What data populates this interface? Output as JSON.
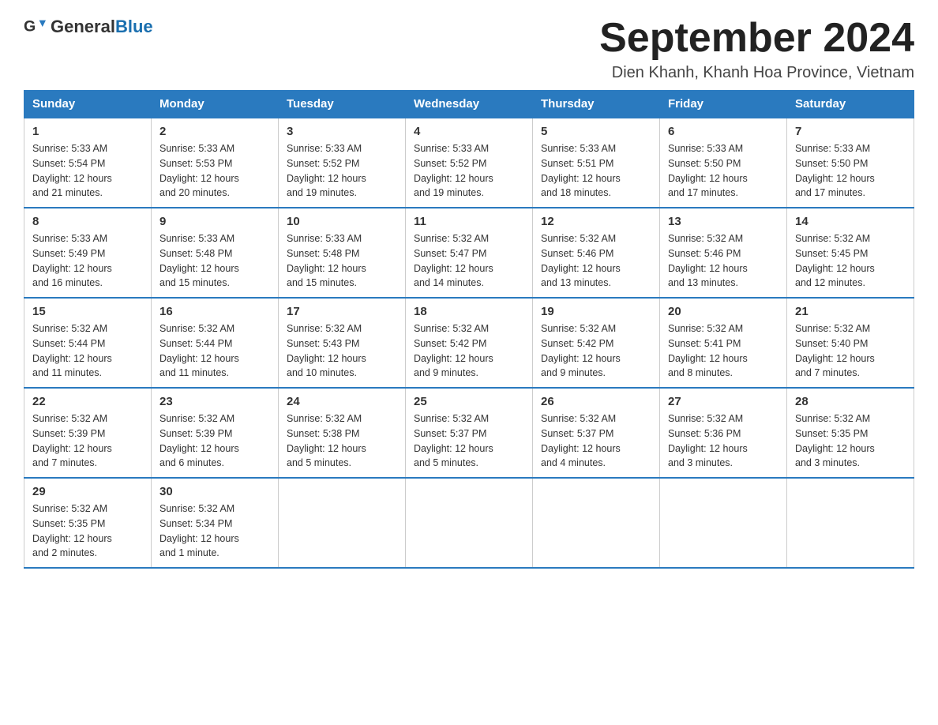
{
  "header": {
    "logo_general": "General",
    "logo_blue": "Blue",
    "month_title": "September 2024",
    "location": "Dien Khanh, Khanh Hoa Province, Vietnam"
  },
  "weekdays": [
    "Sunday",
    "Monday",
    "Tuesday",
    "Wednesday",
    "Thursday",
    "Friday",
    "Saturday"
  ],
  "weeks": [
    [
      {
        "day": "1",
        "sunrise": "5:33 AM",
        "sunset": "5:54 PM",
        "daylight": "12 hours and 21 minutes."
      },
      {
        "day": "2",
        "sunrise": "5:33 AM",
        "sunset": "5:53 PM",
        "daylight": "12 hours and 20 minutes."
      },
      {
        "day": "3",
        "sunrise": "5:33 AM",
        "sunset": "5:52 PM",
        "daylight": "12 hours and 19 minutes."
      },
      {
        "day": "4",
        "sunrise": "5:33 AM",
        "sunset": "5:52 PM",
        "daylight": "12 hours and 19 minutes."
      },
      {
        "day": "5",
        "sunrise": "5:33 AM",
        "sunset": "5:51 PM",
        "daylight": "12 hours and 18 minutes."
      },
      {
        "day": "6",
        "sunrise": "5:33 AM",
        "sunset": "5:50 PM",
        "daylight": "12 hours and 17 minutes."
      },
      {
        "day": "7",
        "sunrise": "5:33 AM",
        "sunset": "5:50 PM",
        "daylight": "12 hours and 17 minutes."
      }
    ],
    [
      {
        "day": "8",
        "sunrise": "5:33 AM",
        "sunset": "5:49 PM",
        "daylight": "12 hours and 16 minutes."
      },
      {
        "day": "9",
        "sunrise": "5:33 AM",
        "sunset": "5:48 PM",
        "daylight": "12 hours and 15 minutes."
      },
      {
        "day": "10",
        "sunrise": "5:33 AM",
        "sunset": "5:48 PM",
        "daylight": "12 hours and 15 minutes."
      },
      {
        "day": "11",
        "sunrise": "5:32 AM",
        "sunset": "5:47 PM",
        "daylight": "12 hours and 14 minutes."
      },
      {
        "day": "12",
        "sunrise": "5:32 AM",
        "sunset": "5:46 PM",
        "daylight": "12 hours and 13 minutes."
      },
      {
        "day": "13",
        "sunrise": "5:32 AM",
        "sunset": "5:46 PM",
        "daylight": "12 hours and 13 minutes."
      },
      {
        "day": "14",
        "sunrise": "5:32 AM",
        "sunset": "5:45 PM",
        "daylight": "12 hours and 12 minutes."
      }
    ],
    [
      {
        "day": "15",
        "sunrise": "5:32 AM",
        "sunset": "5:44 PM",
        "daylight": "12 hours and 11 minutes."
      },
      {
        "day": "16",
        "sunrise": "5:32 AM",
        "sunset": "5:44 PM",
        "daylight": "12 hours and 11 minutes."
      },
      {
        "day": "17",
        "sunrise": "5:32 AM",
        "sunset": "5:43 PM",
        "daylight": "12 hours and 10 minutes."
      },
      {
        "day": "18",
        "sunrise": "5:32 AM",
        "sunset": "5:42 PM",
        "daylight": "12 hours and 9 minutes."
      },
      {
        "day": "19",
        "sunrise": "5:32 AM",
        "sunset": "5:42 PM",
        "daylight": "12 hours and 9 minutes."
      },
      {
        "day": "20",
        "sunrise": "5:32 AM",
        "sunset": "5:41 PM",
        "daylight": "12 hours and 8 minutes."
      },
      {
        "day": "21",
        "sunrise": "5:32 AM",
        "sunset": "5:40 PM",
        "daylight": "12 hours and 7 minutes."
      }
    ],
    [
      {
        "day": "22",
        "sunrise": "5:32 AM",
        "sunset": "5:39 PM",
        "daylight": "12 hours and 7 minutes."
      },
      {
        "day": "23",
        "sunrise": "5:32 AM",
        "sunset": "5:39 PM",
        "daylight": "12 hours and 6 minutes."
      },
      {
        "day": "24",
        "sunrise": "5:32 AM",
        "sunset": "5:38 PM",
        "daylight": "12 hours and 5 minutes."
      },
      {
        "day": "25",
        "sunrise": "5:32 AM",
        "sunset": "5:37 PM",
        "daylight": "12 hours and 5 minutes."
      },
      {
        "day": "26",
        "sunrise": "5:32 AM",
        "sunset": "5:37 PM",
        "daylight": "12 hours and 4 minutes."
      },
      {
        "day": "27",
        "sunrise": "5:32 AM",
        "sunset": "5:36 PM",
        "daylight": "12 hours and 3 minutes."
      },
      {
        "day": "28",
        "sunrise": "5:32 AM",
        "sunset": "5:35 PM",
        "daylight": "12 hours and 3 minutes."
      }
    ],
    [
      {
        "day": "29",
        "sunrise": "5:32 AM",
        "sunset": "5:35 PM",
        "daylight": "12 hours and 2 minutes."
      },
      {
        "day": "30",
        "sunrise": "5:32 AM",
        "sunset": "5:34 PM",
        "daylight": "12 hours and 1 minute."
      },
      null,
      null,
      null,
      null,
      null
    ]
  ],
  "labels": {
    "sunrise_label": "Sunrise:",
    "sunset_label": "Sunset:",
    "daylight_label": "Daylight:"
  }
}
